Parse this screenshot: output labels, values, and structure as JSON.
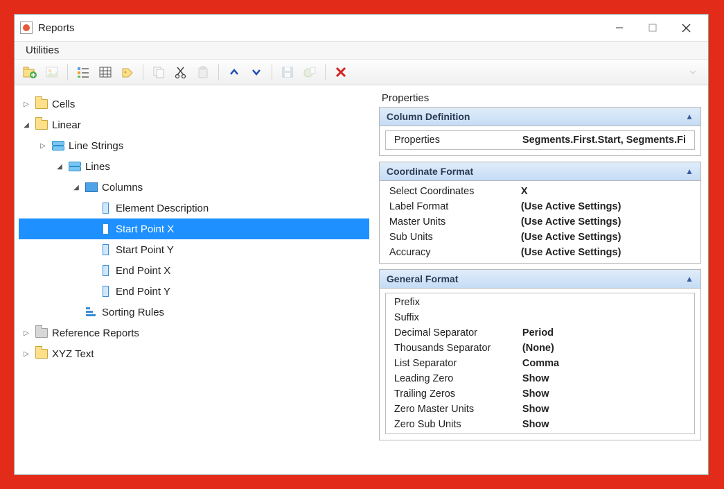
{
  "window": {
    "title": "Reports",
    "menu": {
      "utilities": "Utilities"
    }
  },
  "tree": {
    "cells": "Cells",
    "linear": "Linear",
    "line_strings": "Line Strings",
    "lines": "Lines",
    "columns": "Columns",
    "col_items": [
      "Element Description",
      "Start Point X",
      "Start Point Y",
      "End Point X",
      "End Point Y"
    ],
    "sorting_rules": "Sorting Rules",
    "reference_reports": "Reference Reports",
    "xyz_text": "XYZ Text"
  },
  "props": {
    "title": "Properties",
    "coldef": {
      "head": "Column Definition",
      "rows": [
        {
          "label": "Properties",
          "value": "Segments.First.Start, Segments.Fi"
        }
      ]
    },
    "coord": {
      "head": "Coordinate Format",
      "rows": [
        {
          "label": "Select Coordinates",
          "value": "X"
        },
        {
          "label": "Label Format",
          "value": "(Use Active Settings)"
        },
        {
          "label": "Master Units",
          "value": "(Use Active Settings)"
        },
        {
          "label": "Sub Units",
          "value": "(Use Active Settings)"
        },
        {
          "label": "Accuracy",
          "value": "(Use Active Settings)"
        }
      ]
    },
    "general": {
      "head": "General Format",
      "rows": [
        {
          "label": "Prefix",
          "value": ""
        },
        {
          "label": "Suffix",
          "value": ""
        },
        {
          "label": "Decimal Separator",
          "value": "Period"
        },
        {
          "label": "Thousands Separator",
          "value": "(None)"
        },
        {
          "label": "List Separator",
          "value": "Comma"
        },
        {
          "label": "Leading Zero",
          "value": "Show"
        },
        {
          "label": "Trailing Zeros",
          "value": "Show"
        },
        {
          "label": "Zero Master Units",
          "value": "Show"
        },
        {
          "label": "Zero Sub Units",
          "value": "Show"
        }
      ]
    }
  }
}
